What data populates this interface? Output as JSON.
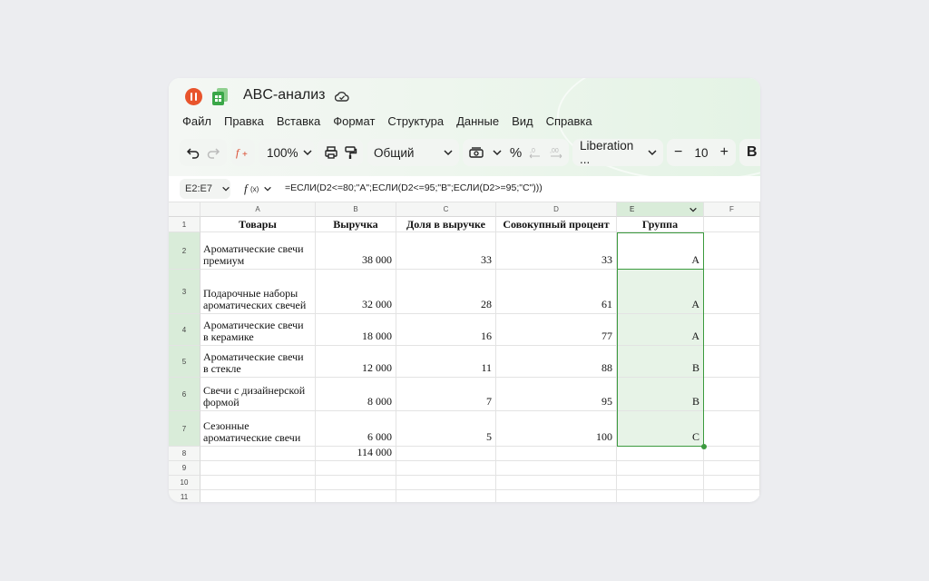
{
  "app": {
    "title": "ABC-анализ"
  },
  "menu": [
    "Файл",
    "Правка",
    "Вставка",
    "Формат",
    "Структура",
    "Данные",
    "Вид",
    "Справка"
  ],
  "toolbar": {
    "zoom": "100%",
    "number_format": "Общий",
    "percent": "%",
    "font_name": "Liberation ...",
    "font_size": "10",
    "minus": "−",
    "plus": "+",
    "bold": "B"
  },
  "formula_bar": {
    "cell_ref": "E2:E7",
    "formula": "=ЕСЛИ(D2<=80;\"A\";ЕСЛИ(D2<=95;\"B\";ЕСЛИ(D2>=95;\"C\")))"
  },
  "sheet": {
    "columns": [
      "A",
      "B",
      "C",
      "D",
      "E",
      "F"
    ],
    "rows": [
      "1",
      "2",
      "3",
      "4",
      "5",
      "6",
      "7",
      "8",
      "9",
      "10",
      "11"
    ],
    "headers": [
      "Товары",
      "Выручка",
      "Доля в выручке",
      "Совокупный процент",
      "Группа"
    ],
    "data": [
      {
        "product": [
          "Ароматические свечи",
          "премиум"
        ],
        "revenue": "38 000",
        "share": "33",
        "cumulative": "33",
        "group": "A"
      },
      {
        "product": [
          "Подарочные наборы",
          "ароматических свечей"
        ],
        "revenue": "32 000",
        "share": "28",
        "cumulative": "61",
        "group": "A"
      },
      {
        "product": [
          "Ароматические свечи",
          "в керамике"
        ],
        "revenue": "18 000",
        "share": "16",
        "cumulative": "77",
        "group": "A"
      },
      {
        "product": [
          "Ароматические свечи",
          "в стекле"
        ],
        "revenue": "12 000",
        "share": "11",
        "cumulative": "88",
        "group": "B"
      },
      {
        "product": [
          "Свечи с дизайнерской",
          "формой"
        ],
        "revenue": "8 000",
        "share": "7",
        "cumulative": "95",
        "group": "B"
      },
      {
        "product": [
          "Сезонные",
          "ароматические свечи"
        ],
        "revenue": "6 000",
        "share": "5",
        "cumulative": "100",
        "group": "C"
      }
    ],
    "total": "114 000"
  },
  "colors": {
    "accent": "#3b9a3e",
    "selection_fill": "#e7f3e7",
    "header_selected": "#d9ecd9"
  }
}
